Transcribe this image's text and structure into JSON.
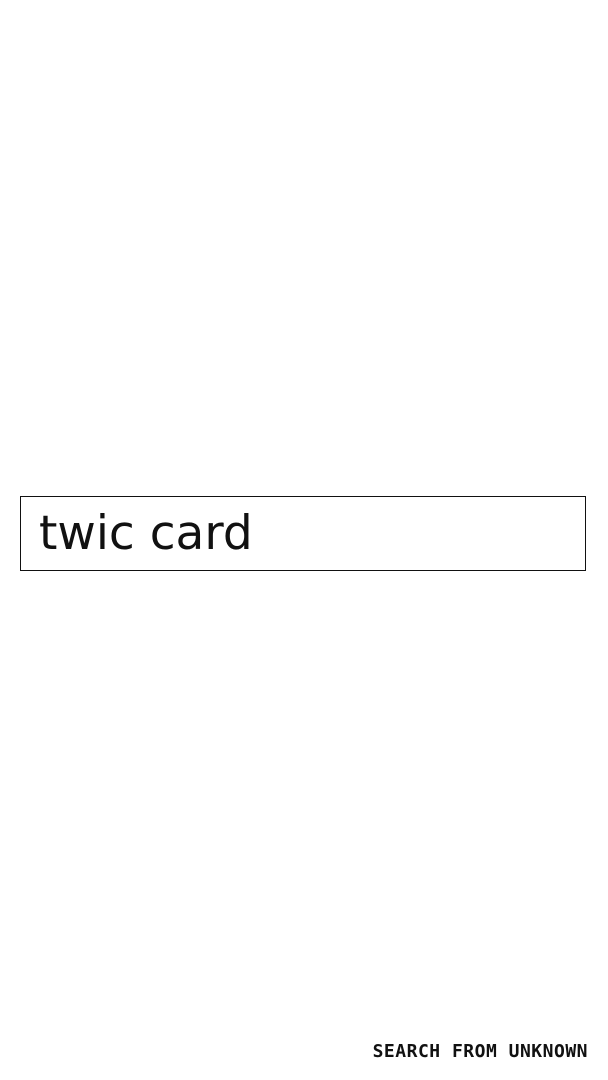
{
  "search": {
    "value": "twic card"
  },
  "footer": {
    "label": "SEARCH FROM UNKNOWN"
  }
}
